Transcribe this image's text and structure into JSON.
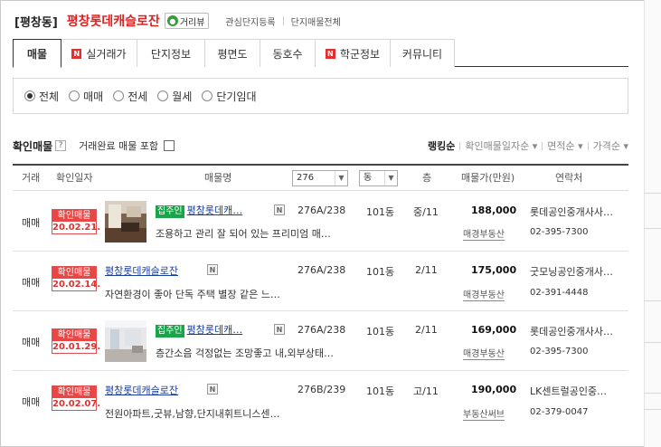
{
  "header": {
    "region": "[평창동]",
    "complex": "평창롯데캐슬로잔",
    "street_view": "거리뷰",
    "links": [
      "관심단지등록",
      "단지매물전체"
    ]
  },
  "tabs": [
    {
      "label": "매물",
      "active": true,
      "badge": ""
    },
    {
      "label": "실거래가",
      "active": false,
      "badge": "N"
    },
    {
      "label": "단지정보",
      "active": false,
      "badge": ""
    },
    {
      "label": "평면도",
      "active": false,
      "badge": ""
    },
    {
      "label": "동호수",
      "active": false,
      "badge": ""
    },
    {
      "label": "학군정보",
      "active": false,
      "badge": "N"
    },
    {
      "label": "커뮤니티",
      "active": false,
      "badge": ""
    }
  ],
  "trade_filter": {
    "selected": "전체",
    "options": [
      "전체",
      "매매",
      "전세",
      "월세",
      "단기임대"
    ]
  },
  "verify": {
    "title": "확인매물",
    "help": "?",
    "include_label": "거래완료 매물 포함"
  },
  "sorts": [
    {
      "label": "랭킹순",
      "active": true
    },
    {
      "label": "확인매물일자순 ▾",
      "active": false
    },
    {
      "label": "면적순 ▾",
      "active": false
    },
    {
      "label": "가격순 ▾",
      "active": false
    }
  ],
  "table": {
    "headers": {
      "trade": "거래",
      "date": "확인일자",
      "name": "매물명",
      "area_select": "276",
      "dong_select": "동",
      "floor": "층",
      "price": "매물가(만원)",
      "contact": "연락처"
    },
    "verified_label": "확인매물",
    "rows": [
      {
        "trade": "매매",
        "date": "20.02.21.",
        "tag": "집주인",
        "title": "평창롯데캐…",
        "new_icon": "N",
        "desc": "조용하고 관리 잘 되어 있는 프리미엄 매…",
        "area": "276A/238",
        "dong": "101동",
        "floor": "중/11",
        "price": "188,000",
        "agent_link": "매경부동산",
        "agent_name": "롯데공인중개사사…",
        "phone": "02-395-7300"
      },
      {
        "trade": "매매",
        "date": "20.02.14.",
        "tag": "",
        "title": "평창롯데캐슬로잔",
        "new_icon": "N",
        "desc": "자연환경이 좋아 단독 주택 별장 같은 느…",
        "area": "276A/238",
        "dong": "101동",
        "floor": "2/11",
        "price": "175,000",
        "agent_link": "매경부동산",
        "agent_name": "굿모닝공인중개사…",
        "phone": "02-391-4448"
      },
      {
        "trade": "매매",
        "date": "20.01.29.",
        "tag": "집주인",
        "title": "평창롯데캐…",
        "new_icon": "N",
        "desc": "층간소음 걱정없는 조망좋고 내,외부상태…",
        "area": "276A/238",
        "dong": "101동",
        "floor": "2/11",
        "price": "169,000",
        "agent_link": "매경부동산",
        "agent_name": "롯데공인중개사사…",
        "phone": "02-395-7300"
      },
      {
        "trade": "매매",
        "date": "20.02.07.",
        "tag": "",
        "title": "평창롯데캐슬로잔",
        "new_icon": "N",
        "desc": "전원아파트,굿뷰,남향,단지내휘트니스센…",
        "area": "276B/239",
        "dong": "101동",
        "floor": "고/11",
        "price": "190,000",
        "agent_link": "부동산써브",
        "agent_name": "LK센트럴공인중…",
        "phone": "02-379-0047"
      }
    ]
  }
}
